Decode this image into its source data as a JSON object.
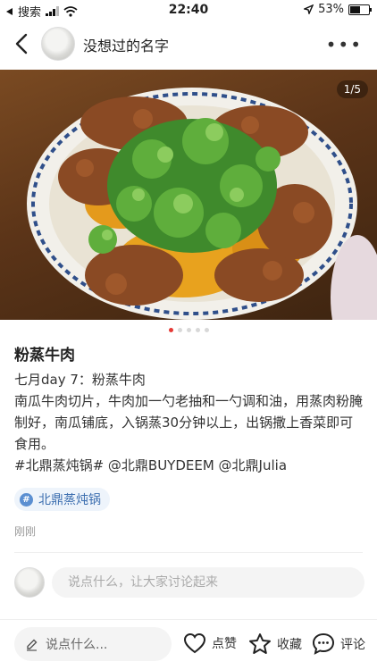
{
  "status": {
    "back_app": "搜索",
    "time": "22:40",
    "battery": "53%",
    "battery_level": 0.53
  },
  "header": {
    "username": "没想过的名字",
    "more": "•••"
  },
  "gallery": {
    "counter": "1/5",
    "total": 5,
    "active_index": 0
  },
  "post": {
    "title": "粉蒸牛肉",
    "lines": [
      "七月day 7：粉蒸牛肉",
      "南瓜牛肉切片，牛肉加一勺老抽和一勺调和油，用蒸肉粉腌制好，南瓜铺底，入锅蒸30分钟以上，出锅撒上香菜即可食用。",
      "#北鼎蒸炖锅# @北鼎BUYDEEM @北鼎Julia"
    ],
    "tag": "北鼎蒸炖锅",
    "time": "刚刚"
  },
  "comment": {
    "placeholder": "说点什么，让大家讨论起来"
  },
  "bottom": {
    "say_placeholder": "说点什么...",
    "like": "点赞",
    "favorite": "收藏",
    "comment": "评论"
  }
}
